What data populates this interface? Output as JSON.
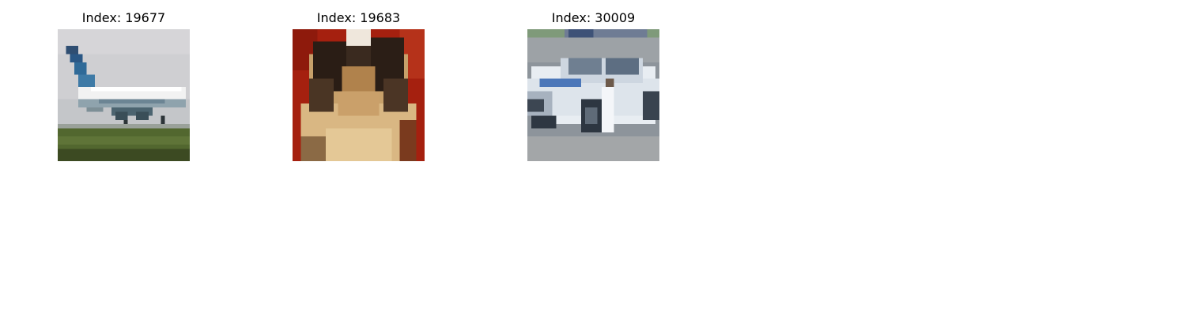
{
  "panels": [
    {
      "title": "Index: 19677",
      "subject": "airplane"
    },
    {
      "title": "Index: 19683",
      "subject": "dog"
    },
    {
      "title": "Index: 30009",
      "subject": "car"
    }
  ]
}
